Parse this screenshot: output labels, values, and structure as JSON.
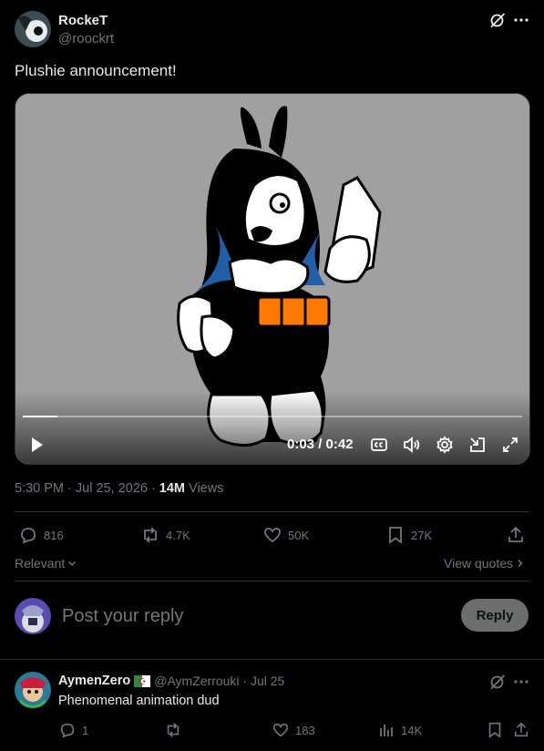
{
  "post": {
    "author_name": "RockeT",
    "author_handle": "@roockrt",
    "text": "Plushie announcement!",
    "timestamp": "5:30 PM · Jul 25, 2026 · ",
    "views_count": "14M",
    "views_label": " Views",
    "video": {
      "time": "0:03 / 0:42",
      "progress": 0.07
    },
    "actions": {
      "replies": "816",
      "reposts": "4.7K",
      "likes": "50K",
      "bookmarks": "27K"
    }
  },
  "filter": {
    "sort_label": "Relevant",
    "view_quotes": "View quotes"
  },
  "composer": {
    "placeholder": "Post your reply",
    "reply_button": "Reply"
  },
  "reply": {
    "author_name": "AymenZero",
    "author_handle": "@AymZerrouki · Jul 25",
    "text": "Phenomenal animation dud",
    "actions": {
      "replies": "1",
      "reposts": "",
      "likes": "183",
      "views": "14K"
    }
  },
  "colors": {
    "background": "#000000",
    "text": "#e7e9ea",
    "muted": "#71767b",
    "divider": "#2f3336",
    "orange": "#ff7a00",
    "blue": "#1f5fa8"
  }
}
